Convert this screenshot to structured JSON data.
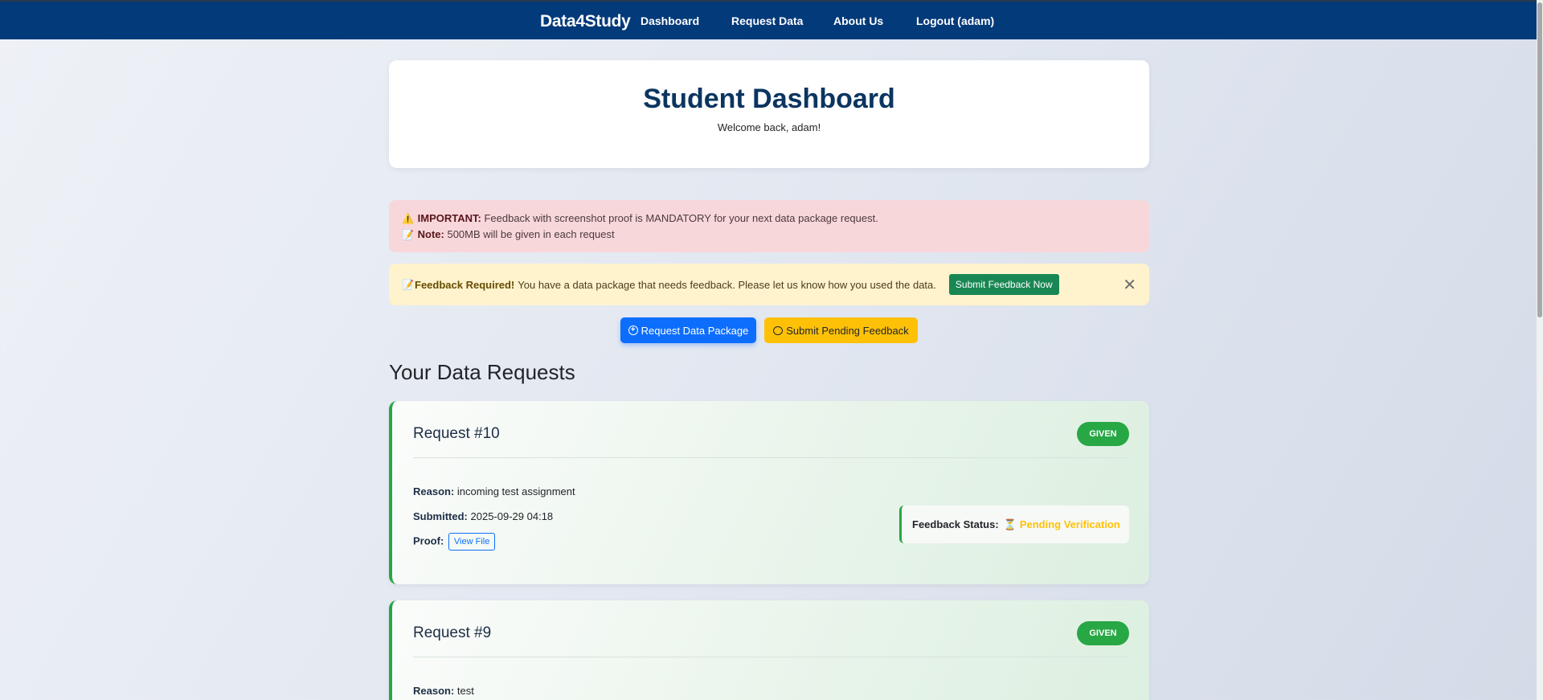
{
  "navbar": {
    "brand": "Data4Study",
    "links": [
      "Dashboard",
      "Request Data",
      "About Us",
      "Logout (adam)"
    ]
  },
  "header": {
    "title": "Student Dashboard",
    "welcome": "Welcome back, adam!"
  },
  "alerts": {
    "important_icon": "⚠️",
    "important_label": "IMPORTANT:",
    "important_text": "Feedback with screenshot proof is MANDATORY for your next data package request.",
    "note_icon": "📝",
    "note_label": "Note:",
    "note_text": "500MB will be given in each request",
    "feedback_icon": "📝",
    "feedback_label": "Feedback Required!",
    "feedback_text": "You have a data package that needs feedback. Please let us know how you used the data.",
    "feedback_button": "Submit Feedback Now",
    "close_glyph": "✕"
  },
  "actions": {
    "request_button": "Request Data Package",
    "feedback_button": "Submit Pending Feedback"
  },
  "section_title": "Your Data Requests",
  "requests": [
    {
      "title": "Request #10",
      "status": "GIVEN",
      "reason_label": "Reason:",
      "reason": "incoming test assignment",
      "submitted_label": "Submitted:",
      "submitted": "2025-09-29 04:18",
      "proof_label": "Proof:",
      "proof_button": "View File",
      "feedback_label": "Feedback Status:",
      "feedback_icon": "⏳",
      "feedback_value": "Pending Verification"
    },
    {
      "title": "Request #9",
      "status": "GIVEN",
      "reason_label": "Reason:",
      "reason": "test"
    }
  ],
  "colors": {
    "navbar": "#023a7a",
    "primary": "#0d6efd",
    "warning": "#ffc107",
    "success": "#28a745",
    "danger_bg": "#f8d7da",
    "warning_bg": "#fff3cd"
  }
}
